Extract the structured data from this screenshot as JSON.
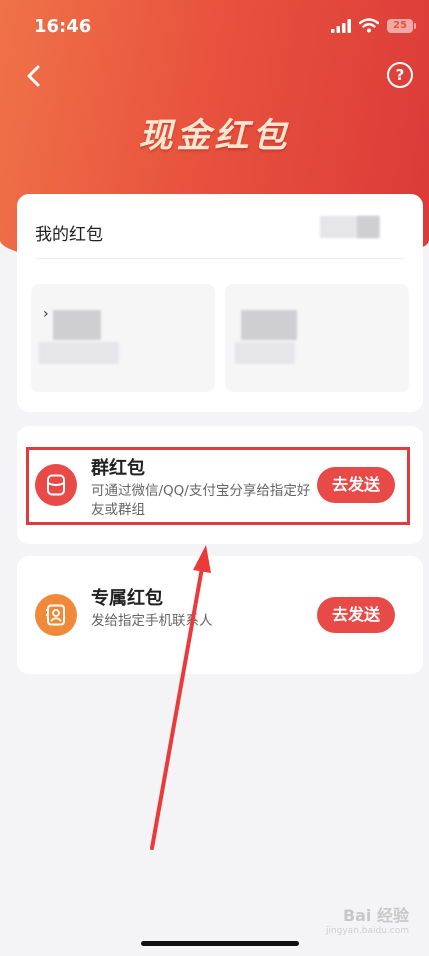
{
  "status_bar": {
    "time": "16:46",
    "battery": "25"
  },
  "header": {
    "title": "现金红包",
    "help_label": "?"
  },
  "my_card": {
    "title": "我的红包",
    "mark": "›"
  },
  "options": [
    {
      "title": "群红包",
      "description": "可通过微信/QQ/支付宝分享给指定好友或群组",
      "button": "去发送"
    },
    {
      "title": "专属红包",
      "description": "发给指定手机联系人",
      "button": "去发送"
    }
  ],
  "watermark": {
    "text": "Bai 经验",
    "sub": "jingyan.baidu.com"
  },
  "colors": {
    "accent": "#e84a48",
    "orange": "#f08a3a",
    "header_start": "#ef7248",
    "header_end": "#db3a38"
  }
}
